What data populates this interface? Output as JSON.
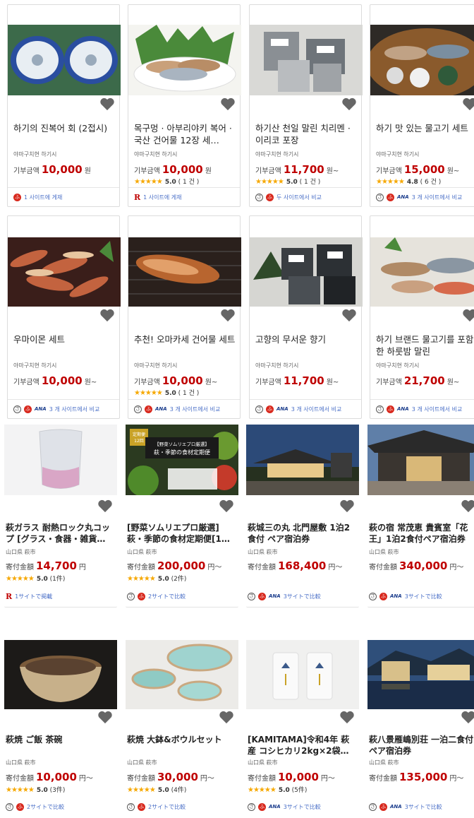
{
  "cards": [
    {
      "title": "하기의 진복어 회 (2접시)",
      "loc": "야마구치현 하기시",
      "price_label": "기부금액",
      "price": "10,000",
      "unit": "원",
      "rating": null,
      "count": null,
      "footer": "1 사이트에 게재",
      "icons": [
        "f"
      ]
    },
    {
      "title": "목구멍 · 아부리야키 복어 · 국산 건어물 12장 세…",
      "loc": "야마구치현 하기시",
      "price_label": "기부금액",
      "price": "10,000",
      "unit": "원",
      "rating": "5.0",
      "count": "( 1 건 )",
      "footer": "1 사이트에 게재",
      "icons": [
        "r"
      ]
    },
    {
      "title": "하기산 천일 말린 치리멘 · 이리코 포장",
      "loc": "야마구치현 하기시",
      "price_label": "기부금액",
      "price": "11,700",
      "unit": "원~",
      "rating": "5.0",
      "count": "( 1 건 )",
      "footer": "두 사이트에서 비교",
      "icons": [
        "s",
        "f"
      ]
    },
    {
      "title": "하기 맛 있는 물고기 세트",
      "loc": "야마구치현 하기시",
      "price_label": "기부금액",
      "price": "15,000",
      "unit": "원~",
      "rating": "4.8",
      "count": "( 6 건 )",
      "footer": "3 개 사이트에서 비교",
      "icons": [
        "s",
        "f",
        "ana"
      ]
    },
    {
      "title": "우마이몬 세트",
      "loc": "야마구치현 하기시",
      "price_label": "기부금액",
      "price": "10,000",
      "unit": "원~",
      "rating": null,
      "count": null,
      "footer": "3 개 사이트에서 비교",
      "icons": [
        "s",
        "f",
        "ana"
      ]
    },
    {
      "title": "추천! 오마카세 건어물 세트",
      "loc": "야마구치현 하기시",
      "price_label": "기부금액",
      "price": "10,000",
      "unit": "원~",
      "rating": "5.0",
      "count": "( 1 건 )",
      "footer": "3 개 사이트에서 비교",
      "icons": [
        "s",
        "f",
        "ana"
      ]
    },
    {
      "title": "고향의 무서운 향기",
      "loc": "야마구치현 하기시",
      "price_label": "기부금액",
      "price": "11,700",
      "unit": "원~",
      "rating": null,
      "count": null,
      "footer": "3 개 사이트에서 비교",
      "icons": [
        "s",
        "f",
        "ana"
      ]
    },
    {
      "title": "하기 브랜드 물고기를 포함한 하룻밤 말린",
      "loc": "야마구치현 하기시",
      "price_label": "기부금액",
      "price": "21,700",
      "unit": "원~",
      "rating": null,
      "count": null,
      "footer": "3 개 사이트에서 비교",
      "icons": [
        "s",
        "f",
        "ana"
      ]
    },
    {
      "title": "萩ガラス 耐熱ロック丸コップ [グラス・食器・雑貨…",
      "loc": "山口県 萩市",
      "price_label": "寄付金額",
      "price": "14,700",
      "unit": "円",
      "rating": "5.0",
      "count": "(1件)",
      "footer": "1サイトで掲載",
      "icons": [
        "r"
      ]
    },
    {
      "title": "[野菜ソムリエプロ厳選] 萩・季節の食材定期便[1…",
      "loc": "山口県 萩市",
      "price_label": "寄付金額",
      "price": "200,000",
      "unit": "円～",
      "rating": "5.0",
      "count": "(2件)",
      "footer": "2サイトで比較",
      "icons": [
        "s",
        "f"
      ],
      "banner": [
        "定期便",
        "12回",
        "【野菜ソムリエプロ厳選】",
        "萩・季節の食材定期便"
      ]
    },
    {
      "title": "萩城三の丸 北門屋敷 1泊2食付 ペア宿泊券",
      "loc": "山口県 萩市",
      "price_label": "寄付金額",
      "price": "168,400",
      "unit": "円～",
      "rating": null,
      "count": null,
      "footer": "3サイトで比較",
      "icons": [
        "s",
        "f",
        "ana"
      ]
    },
    {
      "title": "萩の宿 常茂恵 貴賓室「花王」1泊2食付ペア宿泊券",
      "loc": "山口県 萩市",
      "price_label": "寄付金額",
      "price": "340,000",
      "unit": "円～",
      "rating": null,
      "count": null,
      "footer": "3サイトで比較",
      "icons": [
        "s",
        "f",
        "ana"
      ]
    },
    {
      "title": "萩焼 ご飯 茶碗",
      "loc": "山口県 萩市",
      "price_label": "寄付金額",
      "price": "10,000",
      "unit": "円～",
      "rating": "5.0",
      "count": "(3件)",
      "footer": "2サイトで比較",
      "icons": [
        "s",
        "f"
      ]
    },
    {
      "title": "萩焼 大鉢&ボウルセット",
      "loc": "山口県 萩市",
      "price_label": "寄付金額",
      "price": "30,000",
      "unit": "円～",
      "rating": "5.0",
      "count": "(4件)",
      "footer": "2サイトで比較",
      "icons": [
        "s",
        "f"
      ]
    },
    {
      "title": "[KAMITAMA]令和4年 萩産 コシヒカリ2kg×2袋…",
      "loc": "山口県 萩市",
      "price_label": "寄付金額",
      "price": "10,000",
      "unit": "円～",
      "rating": "5.0",
      "count": "(5件)",
      "footer": "3サイトで比較",
      "icons": [
        "s",
        "f",
        "ana"
      ]
    },
    {
      "title": "萩八景雁嶋別荘 一泊二食付ペア宿泊券",
      "loc": "山口県 萩市",
      "price_label": "寄付金額",
      "price": "135,000",
      "unit": "円～",
      "rating": null,
      "count": null,
      "footer": "3サイトで比較",
      "icons": [
        "s",
        "f",
        "ana"
      ]
    }
  ],
  "icon_glyphs": {
    "stars": "★★★★★",
    "ana": "ANA",
    "r": "R",
    "f": "ふ",
    "s": "さ"
  },
  "colors": {
    "price": "#bf0000",
    "star": "#f6a800",
    "link": "#4a6fc7"
  }
}
